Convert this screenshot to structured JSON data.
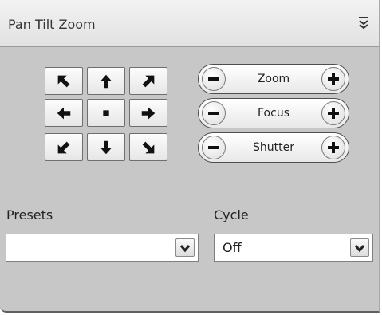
{
  "panel": {
    "title": "Pan Tilt Zoom",
    "collapse_icon": "double-chevron-down-icon"
  },
  "ptz": {
    "directions": [
      {
        "name": "up-left",
        "icon": "arrow-up-left-icon"
      },
      {
        "name": "up",
        "icon": "arrow-up-icon"
      },
      {
        "name": "up-right",
        "icon": "arrow-up-right-icon"
      },
      {
        "name": "left",
        "icon": "arrow-left-icon"
      },
      {
        "name": "stop",
        "icon": "stop-square-icon"
      },
      {
        "name": "right",
        "icon": "arrow-right-icon"
      },
      {
        "name": "down-left",
        "icon": "arrow-down-left-icon"
      },
      {
        "name": "down",
        "icon": "arrow-down-icon"
      },
      {
        "name": "down-right",
        "icon": "arrow-down-right-icon"
      }
    ],
    "controls": [
      {
        "label": "Zoom"
      },
      {
        "label": "Focus"
      },
      {
        "label": "Shutter"
      }
    ]
  },
  "presets": {
    "label": "Presets",
    "value": ""
  },
  "cycle": {
    "label": "Cycle",
    "value": "Off"
  }
}
